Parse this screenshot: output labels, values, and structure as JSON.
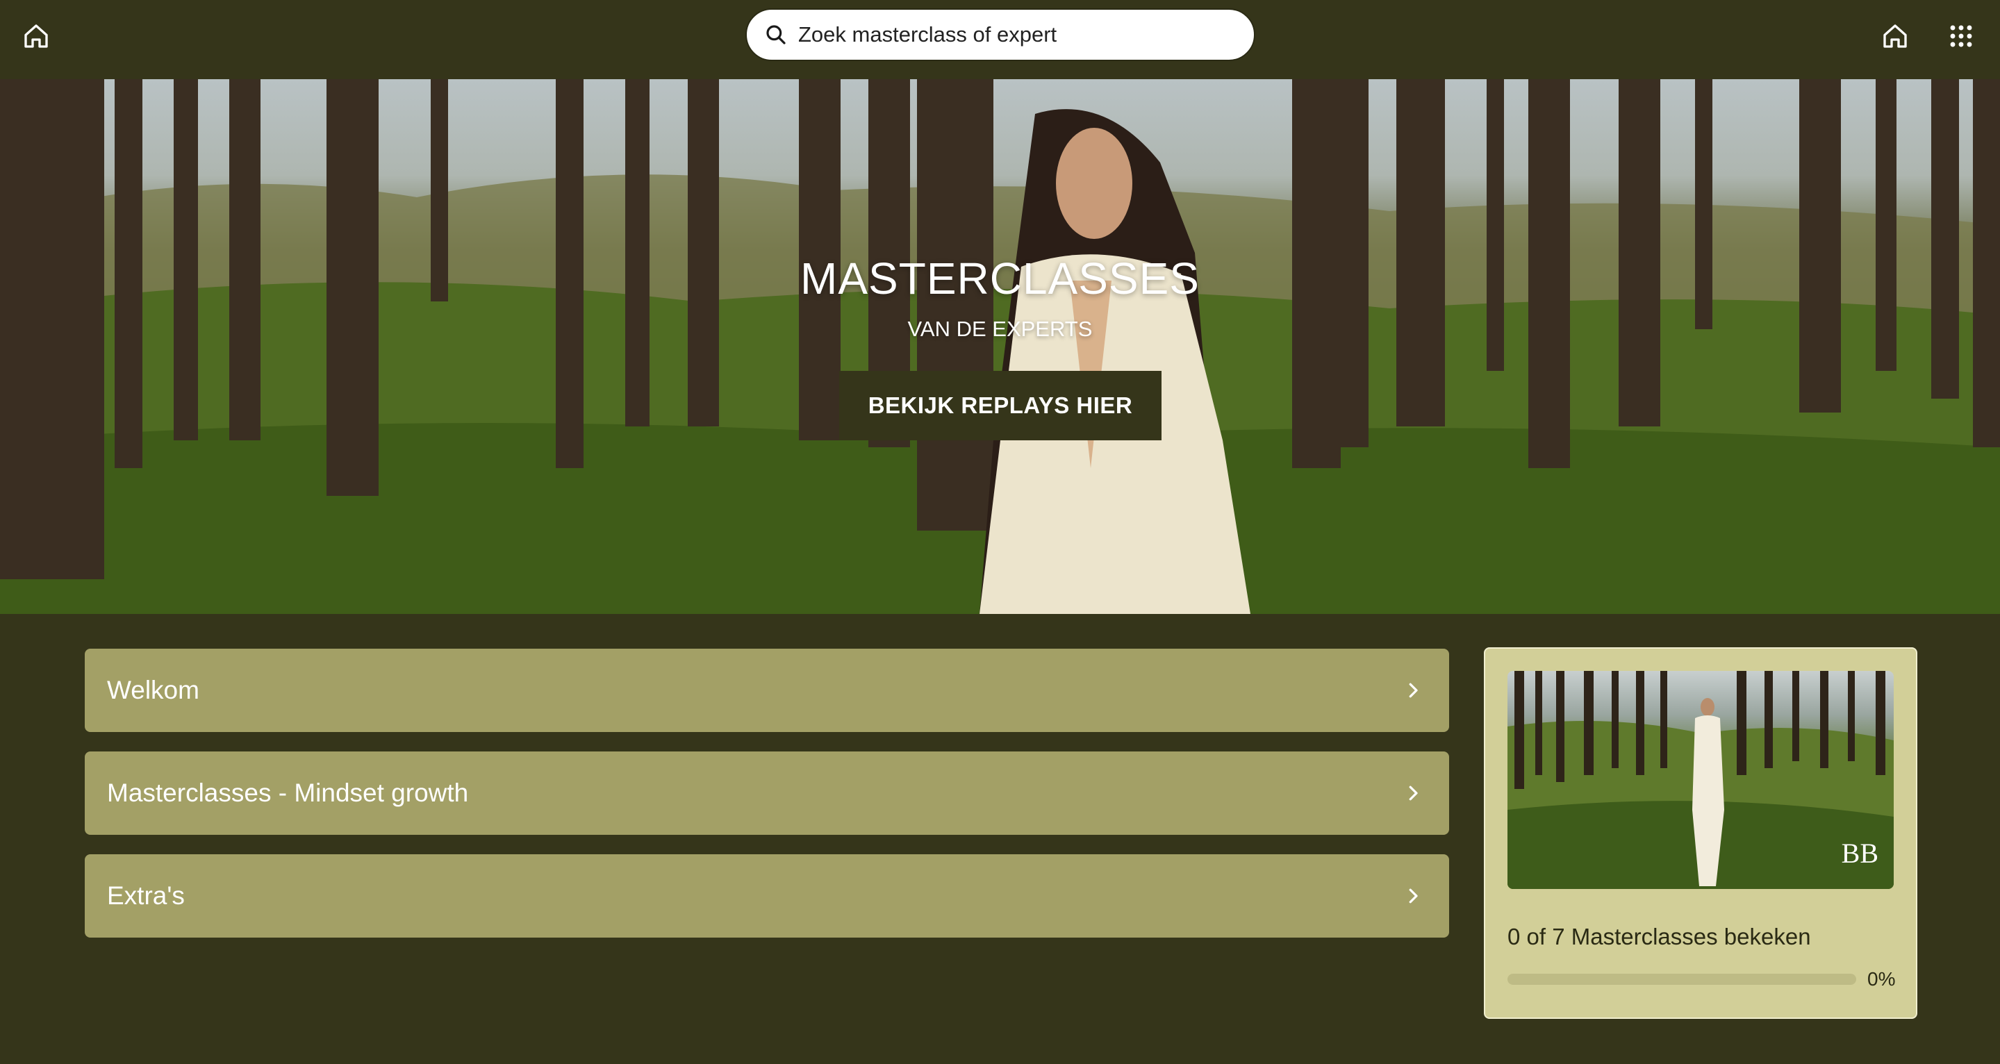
{
  "header": {
    "home_icon_left": "home-icon",
    "search": {
      "placeholder": "Zoek masterclass of expert",
      "value": "",
      "icon": "search-icon"
    },
    "home_icon_right": "home-icon",
    "apps_icon": "grid-icon"
  },
  "hero": {
    "title": "MASTERCLASSES",
    "subtitle": "VAN DE EXPERTS",
    "button_label": "BEKIJK REPLAYS HIER"
  },
  "sections": [
    {
      "label": "Welkom",
      "icon": "chevron-right-icon"
    },
    {
      "label": "Masterclasses - Mindset growth",
      "icon": "chevron-right-icon"
    },
    {
      "label": "Extra's",
      "icon": "chevron-right-icon"
    }
  ],
  "progress_card": {
    "watermark": "BB",
    "summary": "0 of 7 Masterclasses bekeken",
    "percent_label": "0%",
    "progress_fraction": 0.0
  },
  "colors": {
    "background": "#35351a",
    "section_bg": "#a3a066",
    "card_bg": "#d2cf98",
    "button_bg": "#35351a"
  }
}
